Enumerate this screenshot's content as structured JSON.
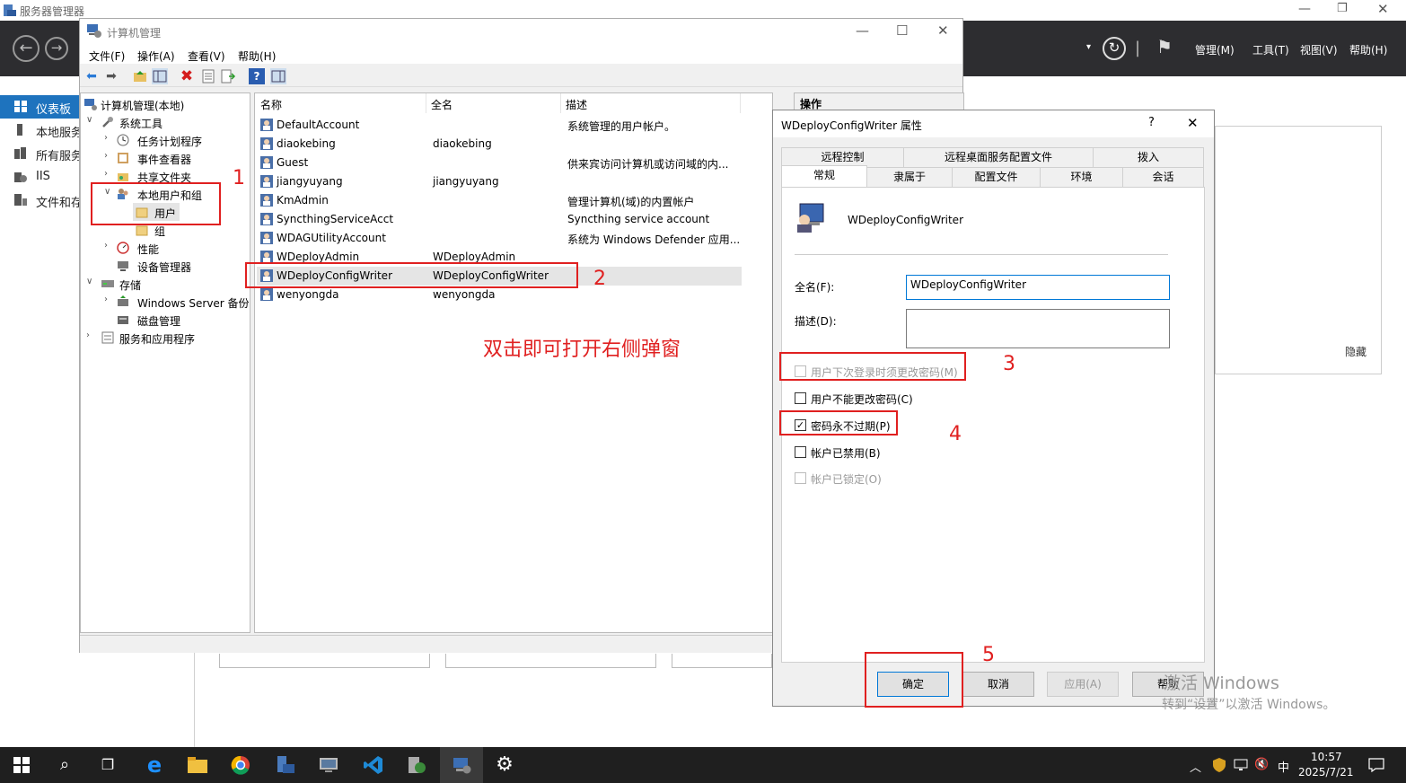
{
  "server_manager": {
    "title": "服务器管理器",
    "menus": [
      "管理(M)",
      "工具(T)",
      "视图(V)",
      "帮助(H)"
    ],
    "sidebar": [
      {
        "label": "仪表板",
        "selected": true
      },
      {
        "label": "本地服务"
      },
      {
        "label": "所有服务"
      },
      {
        "label": "IIS"
      },
      {
        "label": "文件和存"
      }
    ],
    "hide_label": "隐藏"
  },
  "computer_management": {
    "title": "计算机管理",
    "menus": [
      "文件(F)",
      "操作(A)",
      "查看(V)",
      "帮助(H)"
    ],
    "tree": [
      {
        "label": "计算机管理(本地)",
        "expander": ""
      },
      {
        "label": "系统工具",
        "expander": "∨"
      },
      {
        "label": "任务计划程序",
        "expander": "›"
      },
      {
        "label": "事件查看器",
        "expander": "›"
      },
      {
        "label": "共享文件夹",
        "expander": "›"
      },
      {
        "label": "本地用户和组",
        "expander": "∨"
      },
      {
        "label": "用户",
        "expander": "",
        "selected": true
      },
      {
        "label": "组",
        "expander": ""
      },
      {
        "label": "性能",
        "expander": "›"
      },
      {
        "label": "设备管理器",
        "expander": ""
      },
      {
        "label": "存储",
        "expander": "∨"
      },
      {
        "label": "Windows Server 备份",
        "expander": "›"
      },
      {
        "label": "磁盘管理",
        "expander": ""
      },
      {
        "label": "服务和应用程序",
        "expander": "›"
      }
    ],
    "list_headers": [
      "名称",
      "全名",
      "描述"
    ],
    "users": [
      {
        "name": "DefaultAccount",
        "fullname": "",
        "desc": "系统管理的用户帐户。"
      },
      {
        "name": "diaokebing",
        "fullname": "diaokebing",
        "desc": ""
      },
      {
        "name": "Guest",
        "fullname": "",
        "desc": "供来宾访问计算机或访问域的内..."
      },
      {
        "name": "jiangyuyang",
        "fullname": "jiangyuyang",
        "desc": ""
      },
      {
        "name": "KmAdmin",
        "fullname": "",
        "desc": "管理计算机(域)的内置帐户"
      },
      {
        "name": "SyncthingServiceAcct",
        "fullname": "",
        "desc": "Syncthing service account"
      },
      {
        "name": "WDAGUtilityAccount",
        "fullname": "",
        "desc": "系统为 Windows Defender 应用..."
      },
      {
        "name": "WDeployAdmin",
        "fullname": "WDeployAdmin",
        "desc": ""
      },
      {
        "name": "WDeployConfigWriter",
        "fullname": "WDeployConfigWriter",
        "desc": "",
        "selected": true
      },
      {
        "name": "wenyongda",
        "fullname": "wenyongda",
        "desc": ""
      }
    ],
    "action_header": "操作"
  },
  "dialog": {
    "title": "WDeployConfigWriter 属性",
    "help_glyph": "?",
    "tabs_back": [
      "远程控制",
      "远程桌面服务配置文件",
      "拨入"
    ],
    "tabs_front": [
      "常规",
      "隶属于",
      "配置文件",
      "环境",
      "会话"
    ],
    "username": "WDeployConfigWriter",
    "fullname_label": "全名(F):",
    "fullname_value": "WDeployConfigWriter",
    "desc_label": "描述(D):",
    "desc_value": "",
    "checkboxes": [
      {
        "label": "用户下次登录时须更改密码(M)",
        "checked": false,
        "disabled": true
      },
      {
        "label": "用户不能更改密码(C)",
        "checked": false,
        "disabled": false
      },
      {
        "label": "密码永不过期(P)",
        "checked": true,
        "disabled": false
      },
      {
        "label": "帐户已禁用(B)",
        "checked": false,
        "disabled": false
      },
      {
        "label": "帐户已锁定(O)",
        "checked": false,
        "disabled": true
      }
    ],
    "buttons": {
      "ok": "确定",
      "cancel": "取消",
      "apply": "应用(A)",
      "help": "帮助"
    }
  },
  "annotations": {
    "instruction": "双击即可打开右侧弹窗",
    "numbers": [
      "1",
      "2",
      "3",
      "4",
      "5"
    ]
  },
  "watermark": {
    "line1": "激活 Windows",
    "line2": "转到“设置”以激活 Windows。"
  },
  "taskbar": {
    "time": "10:57",
    "date": "2025/7/21",
    "ime": "中"
  },
  "colors": {
    "accent": "#1e73be",
    "annotation": "#e02020",
    "dark_bar": "#2d2d30"
  }
}
